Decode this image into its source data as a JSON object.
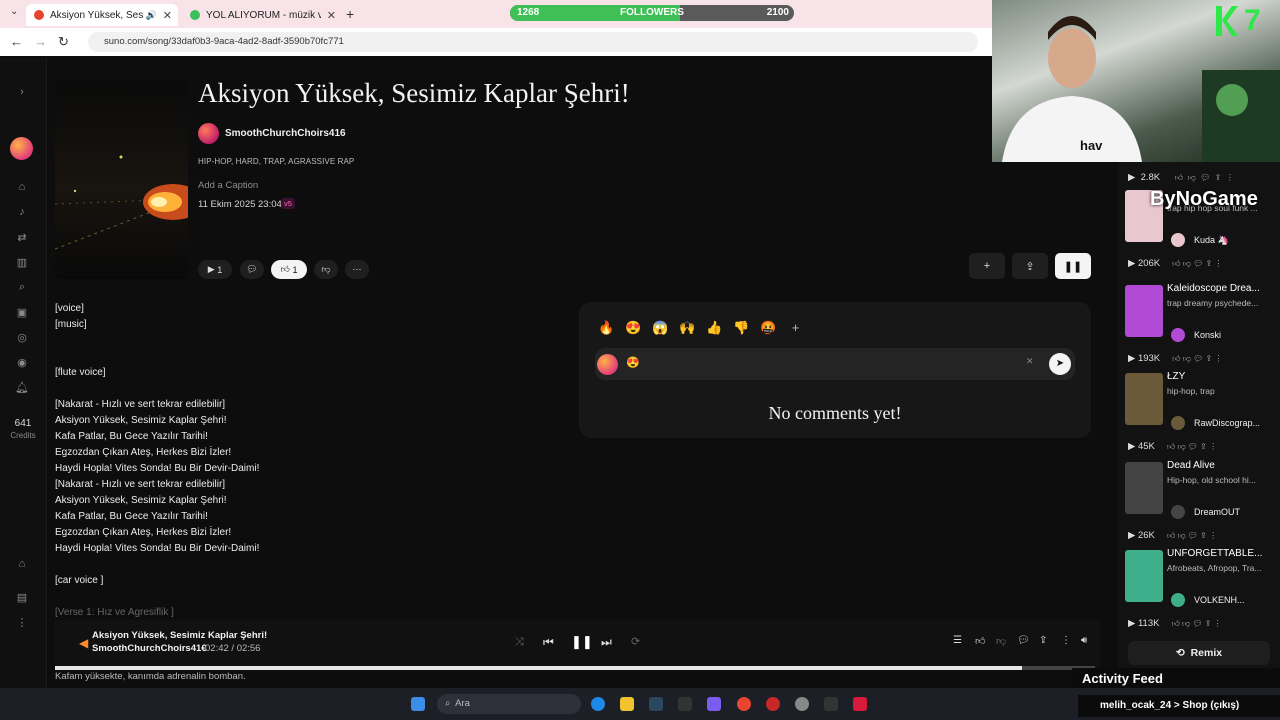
{
  "browser": {
    "tabs": [
      {
        "title": "Aksiyon Yüksek, Sesimiz Ka"
      },
      {
        "title": "YOL ALIYORUM - müzik ve şark"
      }
    ],
    "url": "suno.com/song/33daf0b3-9aca-4ad2-8adf-3590b70fc771"
  },
  "stream": {
    "followers_label": "FOLLOWERS",
    "followers_current": "1268",
    "followers_goal": "2100",
    "followers_fraction": 0.6,
    "cam_logo": "7",
    "overlay_brand": "ByNoGame",
    "activity_feed_label": "Activity Feed",
    "ticker": "melih_ocak_24 > Shop (çıkış)"
  },
  "rail": {
    "credits_value": "641",
    "credits_label": "Credits"
  },
  "song": {
    "title": "Aksiyon Yüksek, Sesimiz Kaplar Şehri!",
    "artist": "SmoothChurchChoirs416",
    "genres": "HIP-HOP, HARD, TRAP, AGRASSIVE RAP",
    "caption_placeholder": "Add a Caption",
    "datetime": "11 Ekim 2025 23:04",
    "version": "v5",
    "play_count": "1",
    "like_count": "1"
  },
  "lyrics": [
    {
      "text": "[voice]"
    },
    {
      "text": "[music]"
    },
    {
      "text": ""
    },
    {
      "text": ""
    },
    {
      "text": "[flute voice]"
    },
    {
      "text": ""
    },
    {
      "text": "[Nakarat - Hızlı ve sert tekrar edilebilir]"
    },
    {
      "text": "Aksiyon Yüksek, Sesimiz Kaplar Şehri!"
    },
    {
      "text": "Kafa Patlar, Bu Gece Yazılır Tarihi!"
    },
    {
      "text": "Egzozdan Çıkan Ateş, Herkes Bizi İzler!"
    },
    {
      "text": "Haydi Hopla! Vites Sonda! Bu Bir Devir-Daimi!"
    },
    {
      "text": "[Nakarat - Hızlı ve sert tekrar edilebilir]"
    },
    {
      "text": "Aksiyon Yüksek, Sesimiz Kaplar Şehri!"
    },
    {
      "text": "Kafa Patlar, Bu Gece Yazılır Tarihi!"
    },
    {
      "text": "Egzozdan Çıkan Ateş, Herkes Bizi İzler!"
    },
    {
      "text": "Haydi Hopla! Vites Sonda! Bu Bir Devir-Daimi!"
    },
    {
      "text": ""
    },
    {
      "text": "[car voice ]"
    },
    {
      "text": ""
    },
    {
      "text": "[Verse 1: Hız ve Agresiflik ]"
    }
  ],
  "comments": {
    "reactions": [
      "🔥",
      "😍",
      "😱",
      "🙌",
      "👍",
      "👎",
      "🤬"
    ],
    "selected_reaction": "😍",
    "empty_text": "No comments yet!"
  },
  "player": {
    "title": "Aksiyon Yüksek, Sesimiz Kaplar Şehri!",
    "artist": "SmoothChurchChoirs41€",
    "time": "02:42 / 02:56",
    "progress_fraction": 0.93,
    "below_text": "Kafam yüksekte, kanımda adrenalin bomban."
  },
  "feed": {
    "top_row": {
      "plays": "2.8K"
    },
    "cards": [
      {
        "title": "",
        "tags": "trap hip hop soul funk ...",
        "user": "Kuda 🦄",
        "plays": "206K",
        "thumb": "#e9c7cf"
      },
      {
        "title": "Kaleidoscope Drea...",
        "tags": "trap dreamy psychede...",
        "user": "Konski",
        "plays": "193K",
        "thumb": "#b14bd6"
      },
      {
        "title": "ŁZY",
        "tags": "hip-hop, trap",
        "user": "RawDiscograp...",
        "plays": "45K",
        "thumb": "#6a5a3a"
      },
      {
        "title": "Dead Alive",
        "tags": "Hip-hop, old school hi...",
        "user": "DreamOUT",
        "plays": "26K",
        "thumb": "#444444"
      },
      {
        "title": "UNFORGETTABLE...",
        "tags": "Afrobeats, Afropop, Tra...",
        "user": "VOLKENH...",
        "plays": "113K",
        "thumb": "#3fae8a"
      }
    ],
    "remix_label": "Remix"
  },
  "taskbar": {
    "search_placeholder": "Ara"
  },
  "colors": {
    "accent_pink": "#ff62b0",
    "progress_green": "#3fbf55",
    "cam_green": "#2ee84a"
  }
}
